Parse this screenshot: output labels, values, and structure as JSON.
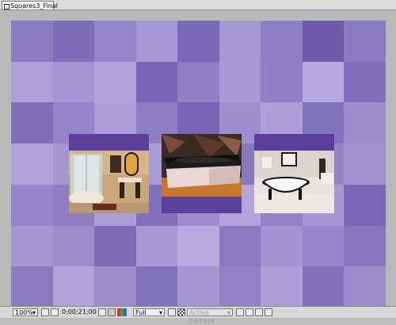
{
  "window": {
    "tab_title": "Squares3_Final"
  },
  "grid_colors": [
    [
      "#8b7cc0",
      "#7d6db8",
      "#9486c9",
      "#a799d6",
      "#7a69b6",
      "#a598d5",
      "#8e7fc3",
      "#6d5aad",
      "#8a7bc0"
    ],
    [
      "#ad9fd9",
      "#a395d3",
      "#b1a4dc",
      "#7865b4",
      "#8e7fc4",
      "#a798d6",
      "#9081c5",
      "#b4a8de",
      "#7f6fbb"
    ],
    [
      "#7f6fbb",
      "#9484c7",
      "#ab9dd8",
      "#8d7ec3",
      "#7764b3",
      "#9e90cf",
      "#ab9ed9",
      "#8072bc",
      "#9b8ccc"
    ],
    [
      "#b0a2da",
      "#a495d3",
      "#7866b5",
      "#a99bd6",
      "#9384c7",
      "#8677bf",
      "#b6aadf",
      "#9183c6",
      "#a091cf"
    ],
    [
      "#9485c8",
      "#8d7ec3",
      "#ab9dd8",
      "#8171bc",
      "#9d8ecd",
      "#b2a5dc",
      "#9182c6",
      "#a597d4",
      "#7a68b6"
    ],
    [
      "#a597d4",
      "#9b8dcc",
      "#7c6bb7",
      "#a698d5",
      "#b7aadf",
      "#8a7bc0",
      "#a294d2",
      "#9587c9",
      "#8574be"
    ],
    [
      "#8b7cc0",
      "#b0a3db",
      "#9a8bcc",
      "#8273bd",
      "#a597d4",
      "#9283c6",
      "#ab9ed9",
      "#8171bc",
      "#9b8dcd"
    ]
  ],
  "photos": [
    {
      "name": "shower-bath-photo",
      "bar_position": "top"
    },
    {
      "name": "black-tub-photo",
      "bar_position": "bottom"
    },
    {
      "name": "clawfoot-tub-photo",
      "bar_position": "top"
    }
  ],
  "statusbar": {
    "zoom": "100%",
    "timecode": "0;00;21;00",
    "resolution": "Full",
    "camera": "Active Camera"
  }
}
